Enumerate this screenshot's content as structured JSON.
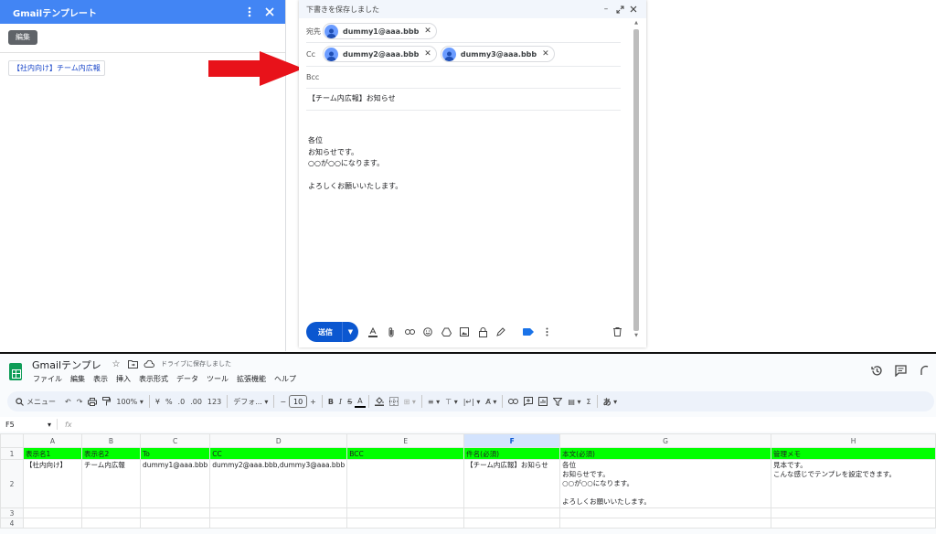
{
  "addon": {
    "title": "Gmailテンプレート",
    "edit_label": "編集",
    "template_link": "【社内向け】チーム内広報",
    "colors": {
      "header": "#4285f4"
    }
  },
  "compose": {
    "header_status": "下書きを保存しました",
    "to_label": "宛先",
    "cc_label": "Cc",
    "bcc_label": "Bcc",
    "to_chips": [
      "dummy1@aaa.bbb"
    ],
    "cc_chips": [
      "dummy2@aaa.bbb",
      "dummy3@aaa.bbb"
    ],
    "subject": "【チーム内広報】お知らせ",
    "body_lines": [
      "各位",
      "お知らせです。",
      "○○が○○になります。",
      "",
      "よろしくお願いいたします。"
    ],
    "send_label": "送信",
    "toolbar_icons": [
      "format-text-icon",
      "attach-icon",
      "link-icon",
      "emoji-icon",
      "drive-icon",
      "photo-icon",
      "lock-icon",
      "signature-icon",
      "label-icon",
      "more-icon"
    ]
  },
  "sheets": {
    "title": "Gmailテンプレ",
    "saved_status": "ドライブに保存しました",
    "menu": [
      "ファイル",
      "編集",
      "表示",
      "挿入",
      "表示形式",
      "データ",
      "ツール",
      "拡張機能",
      "ヘルプ"
    ],
    "toolbar": {
      "search": "メニュー",
      "zoom": "100%",
      "currency": "¥",
      "percent": "%",
      "dec_minus": ".0",
      "dec_plus": ".00",
      "num_format": "123",
      "font": "デフォ...",
      "font_size": "10",
      "input_tool": "あ"
    },
    "name_box": "F5",
    "fx": "fx",
    "columns": [
      "A",
      "B",
      "C",
      "D",
      "E",
      "F",
      "G",
      "H"
    ],
    "selected_column": "F",
    "rows": [
      {
        "num": "1",
        "cells": [
          "表示名1",
          "表示名2",
          "To",
          "CC",
          "BCC",
          "件名(必須)",
          "本文(必須)",
          "管理メモ"
        ]
      },
      {
        "num": "2",
        "cells": [
          "【社内向け】",
          "チーム内広報",
          "dummy1@aaa.bbb",
          "dummy2@aaa.bbb,dummy3@aaa.bbb",
          "",
          "【チーム内広報】お知らせ",
          "各位\nお知らせです。\n○○が○○になります。\n\nよろしくお願いいたします。",
          "見本です。\nこんな感じでテンプレを設定できます。"
        ]
      },
      {
        "num": "3",
        "cells": [
          "",
          "",
          "",
          "",
          "",
          "",
          "",
          ""
        ]
      },
      {
        "num": "4",
        "cells": [
          "",
          "",
          "",
          "",
          "",
          "",
          "",
          ""
        ]
      }
    ],
    "colors": {
      "header_row_fill": "#00ff00",
      "selected": "#d3e3fd"
    }
  }
}
